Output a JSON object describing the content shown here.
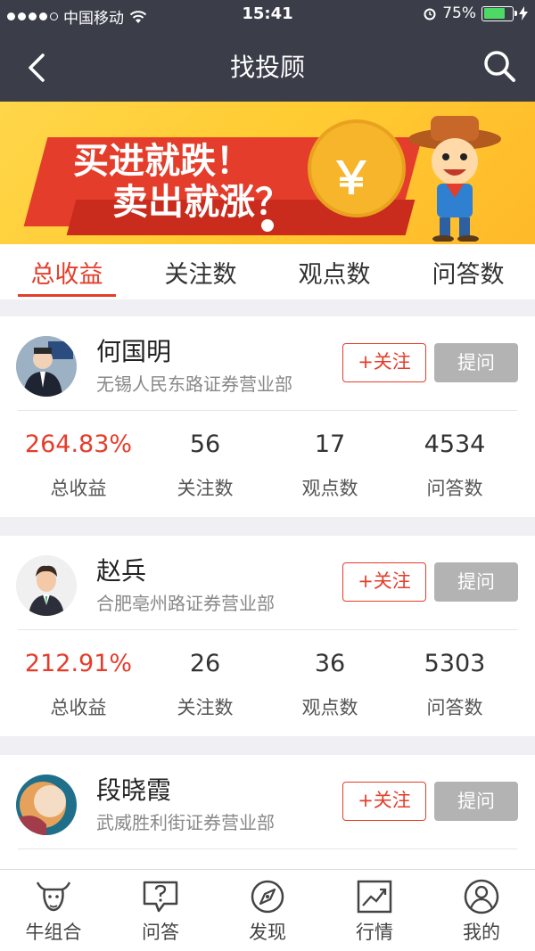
{
  "status_bar": {
    "carrier": "中国移动",
    "time": "15:41",
    "battery": "75%",
    "battery_level": 0.75
  },
  "nav": {
    "title": "找投顾",
    "back_icon": "chevron-left-icon",
    "search_icon": "search-icon"
  },
  "banner": {
    "line1": "买进就跌！",
    "line2": "卖出就涨？",
    "coin_symbol": "￥"
  },
  "tabs": [
    {
      "label": "总收益",
      "active": true
    },
    {
      "label": "关注数",
      "active": false
    },
    {
      "label": "观点数",
      "active": false
    },
    {
      "label": "问答数",
      "active": false
    }
  ],
  "advisors": [
    {
      "name": "何国明",
      "branch": "无锡人民东路证券营业部",
      "follow_label": "+关注",
      "ask_label": "提问",
      "stats": [
        {
          "value": "264.83%",
          "label": "总收益"
        },
        {
          "value": "56",
          "label": "关注数"
        },
        {
          "value": "17",
          "label": "观点数"
        },
        {
          "value": "4534",
          "label": "问答数"
        }
      ]
    },
    {
      "name": "赵兵",
      "branch": "合肥亳州路证券营业部",
      "follow_label": "+关注",
      "ask_label": "提问",
      "stats": [
        {
          "value": "212.91%",
          "label": "总收益"
        },
        {
          "value": "26",
          "label": "关注数"
        },
        {
          "value": "36",
          "label": "观点数"
        },
        {
          "value": "5303",
          "label": "问答数"
        }
      ]
    },
    {
      "name": "段晓霞",
      "branch": "武威胜利街证券营业部",
      "follow_label": "+关注",
      "ask_label": "提问"
    }
  ],
  "tabbar": [
    {
      "label": "牛组合",
      "icon": "bull-icon"
    },
    {
      "label": "问答",
      "icon": "question-bubble-icon"
    },
    {
      "label": "发现",
      "icon": "compass-icon"
    },
    {
      "label": "行情",
      "icon": "chart-icon"
    },
    {
      "label": "我的",
      "icon": "user-icon"
    }
  ],
  "colors": {
    "header_bg": "#3b3d49",
    "accent": "#e43d2b",
    "ask_button": "#b3b3b3"
  }
}
